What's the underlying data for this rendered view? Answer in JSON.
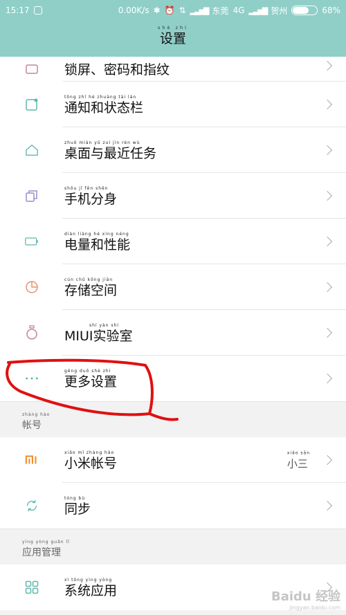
{
  "status_bar": {
    "time": "15:17",
    "speed": "0.00K/s",
    "carrier1": "东莞",
    "network": "4G",
    "carrier2": "贺州",
    "battery": "68%",
    "battery_level": 0.68
  },
  "header": {
    "pinyin": "shè zhì",
    "title": "设置"
  },
  "items_top": [
    {
      "pinyin": "",
      "label": "锁屏、密码和指纹",
      "icon": "lock-icon"
    },
    {
      "pinyin": "tōng zhī hé zhuàng tài lán",
      "label": "通知和状态栏",
      "icon": "notification-icon"
    },
    {
      "pinyin": "zhuō miàn yǔ zuì jìn rèn wù",
      "label": "桌面与最近任务",
      "icon": "home-icon"
    },
    {
      "pinyin": "shǒu jī fēn shēn",
      "label": "手机分身",
      "icon": "dual-apps-icon"
    },
    {
      "pinyin": "diàn liàng hé xìng néng",
      "label": "电量和性能",
      "icon": "battery-icon"
    },
    {
      "pinyin": "cún chǔ kōng jiān",
      "label": "存储空间",
      "icon": "storage-icon"
    },
    {
      "pinyin": "shí yàn shì",
      "label": "MIUI实验室",
      "icon": "lab-flask-icon"
    },
    {
      "pinyin": "gēng duō shè zhì",
      "label": "更多设置",
      "icon": "more-dots-icon"
    }
  ],
  "section_account": {
    "pinyin": "zhàng hào",
    "label": "帐号"
  },
  "items_account": [
    {
      "pinyin": "xiǎo mǐ zhàng hào",
      "label": "小米帐号",
      "icon": "mi-logo-icon",
      "value": "小三",
      "value_pinyin": "xiǎo sān"
    },
    {
      "pinyin": "tóng bù",
      "label": "同步",
      "icon": "sync-icon"
    }
  ],
  "section_apps": {
    "pinyin": "yìng yòng guǎn lǐ",
    "label": "应用管理"
  },
  "items_apps": [
    {
      "pinyin": "xì tǒng yìng yòng",
      "label": "系统应用",
      "icon": "grid-apps-icon"
    }
  ],
  "watermark": {
    "brand": "Baidu 经验",
    "url": "jingyan.baidu.com"
  },
  "colors": {
    "accent": "#8fcfc8",
    "icon_teal": "#5fb8ad",
    "annotation_red": "#e01010"
  }
}
